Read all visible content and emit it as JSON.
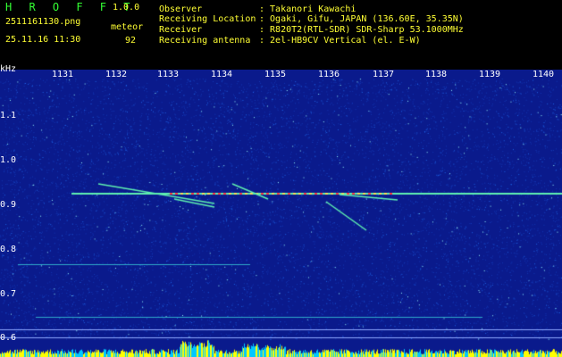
{
  "header": {
    "app_name": "H R O F F T",
    "app_version": "1.0.0",
    "filename": "2511161130.png",
    "datetime": "25.11.16 11:30",
    "meteor_label": "meteor",
    "meteor_count": "92",
    "info": [
      {
        "label": "Observer",
        "value": ": Takanori Kawachi"
      },
      {
        "label": "Receiving Location",
        "value": ": Ogaki, Gifu, JAPAN (136.60E, 35.35N)"
      },
      {
        "label": "Receiver",
        "value": ": R820T2(RTL-SDR) SDR-Sharp 53.1000MHz"
      },
      {
        "label": "Receiving antenna",
        "value": ": 2el-HB9CV Vertical (el. E-W)"
      }
    ]
  },
  "spectrogram": {
    "y_unit": "kHz",
    "y_ticks": [
      "1.1",
      "1.0",
      "0.9",
      "0.8",
      "0.7",
      "0.6"
    ],
    "x_ticks": [
      "1131",
      "1132",
      "1133",
      "1134",
      "1135",
      "1136",
      "1137",
      "1138",
      "1139",
      "1140"
    ],
    "colors": {
      "background": "#0a1a8c",
      "noise": "#1e64e6",
      "signal": "#5ef0b0",
      "peak": "#ff4040",
      "power": "#ffff00",
      "power_low": "#00c8ff"
    }
  }
}
